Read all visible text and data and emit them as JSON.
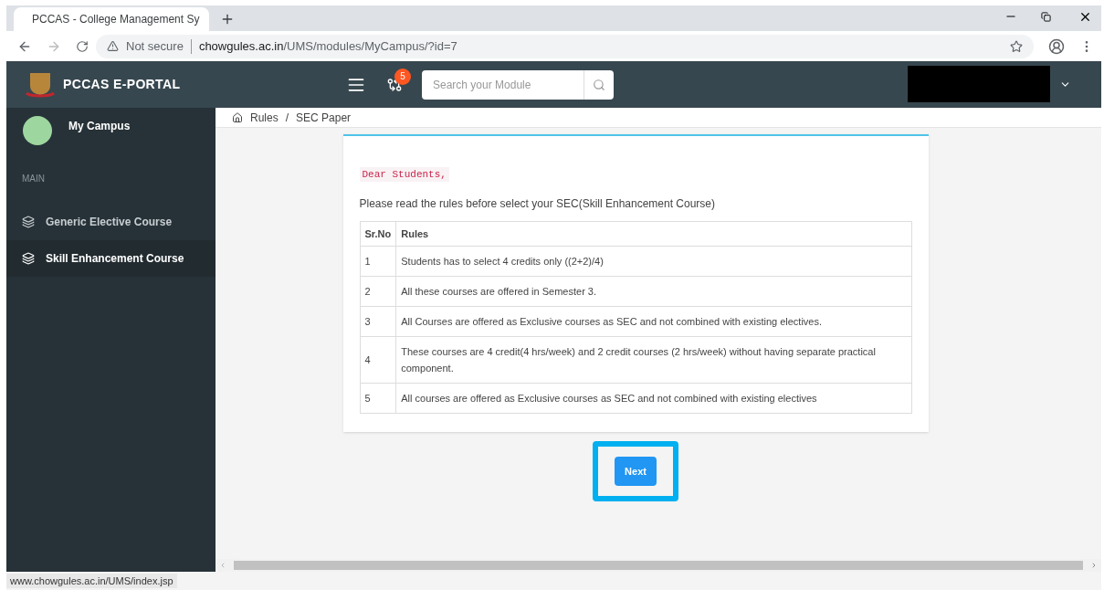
{
  "browser": {
    "tab_title": "PCCAS - College Management Sy",
    "not_secure": "Not secure",
    "url_host": "chowgules.ac.in",
    "url_path": "/UMS/modules/MyCampus/?id=7",
    "status_url": "www.chowgules.ac.in/UMS/index.jsp"
  },
  "header": {
    "brand": "PCCAS E-PORTAL",
    "notification_count": "5",
    "search": {
      "placeholder": "Search your Module"
    }
  },
  "sidebar": {
    "user": "My Campus",
    "section": "MAIN",
    "items": [
      {
        "label": "Generic Elective Course",
        "selected": false
      },
      {
        "label": "Skill Enhancement Course",
        "selected": true
      }
    ]
  },
  "breadcrumb": [
    "Rules",
    "SEC Paper"
  ],
  "breadcrumb_separator": "/",
  "card": {
    "greeting": "Dear Students,",
    "intro": "Please read the rules before select your SEC(Skill Enhancement Course)",
    "columns": [
      "Sr.No",
      "Rules"
    ],
    "rows": [
      [
        "1",
        "Students has to select 4 credits only ((2+2)/4)"
      ],
      [
        "2",
        "All these courses are offered in Semester 3."
      ],
      [
        "3",
        "All Courses are offered as Exclusive courses as SEC and not combined with existing electives."
      ],
      [
        "4",
        "These courses are 4 credit(4 hrs/week) and 2 credit courses (2 hrs/week) without having separate practical component."
      ],
      [
        "5",
        "All courses are offered as Exclusive courses as SEC and not combined with existing electives"
      ]
    ]
  },
  "next_button": "Next"
}
